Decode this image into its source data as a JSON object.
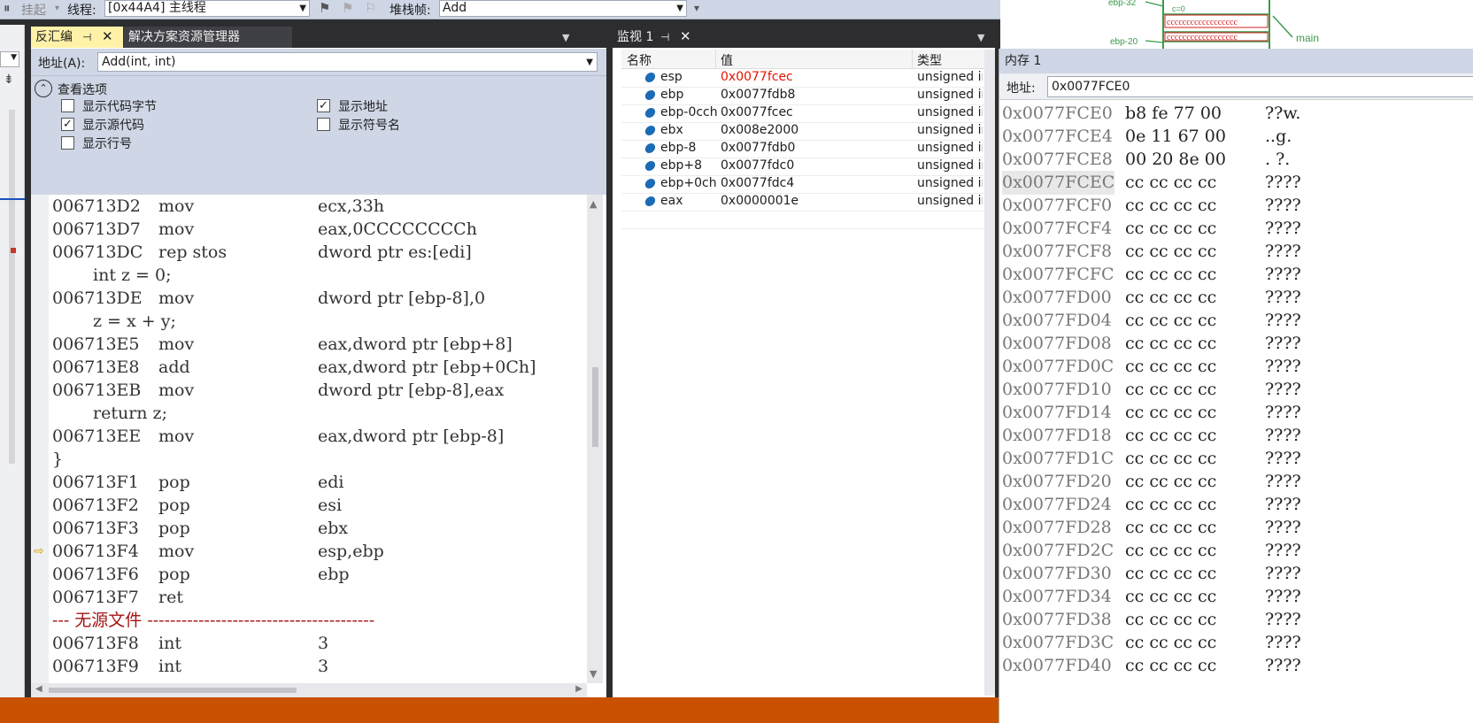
{
  "toolbar": {
    "suspend_label": "挂起",
    "thread_label": "线程:",
    "thread_value": "[0x44A4] 主线程",
    "stackframe_label": "堆栈帧:",
    "stackframe_value": "Add"
  },
  "disasm": {
    "tab_active": "反汇编",
    "tab_inactive": "解决方案资源管理器",
    "address_label": "地址(A):",
    "address_value": "Add(int, int)",
    "options_title": "查看选项",
    "options": [
      {
        "label": "显示代码字节",
        "checked": false
      },
      {
        "label": "显示源代码",
        "checked": true
      },
      {
        "label": "显示行号",
        "checked": false
      },
      {
        "label": "显示地址",
        "checked": true
      },
      {
        "label": "显示符号名",
        "checked": false
      }
    ],
    "lines": [
      {
        "addr": "006713D2",
        "mnem": "mov",
        "ops": "ecx,33h"
      },
      {
        "addr": "006713D7",
        "mnem": "mov",
        "ops": "eax,0CCCCCCCCh"
      },
      {
        "addr": "006713DC",
        "mnem": "rep stos",
        "ops": "dword ptr es:[edi]"
      },
      {
        "src": "int z = 0;"
      },
      {
        "addr": "006713DE",
        "mnem": "mov",
        "ops": "dword ptr [ebp-8],0"
      },
      {
        "src": "z = x + y;"
      },
      {
        "addr": "006713E5",
        "mnem": "mov",
        "ops": "eax,dword ptr [ebp+8]"
      },
      {
        "addr": "006713E8",
        "mnem": "add",
        "ops": "eax,dword ptr [ebp+0Ch]"
      },
      {
        "addr": "006713EB",
        "mnem": "mov",
        "ops": "dword ptr [ebp-8],eax"
      },
      {
        "src": "return z;"
      },
      {
        "addr": "006713EE",
        "mnem": "mov",
        "ops": "eax,dword ptr [ebp-8]"
      },
      {
        "brace": "}"
      },
      {
        "addr": "006713F1",
        "mnem": "pop",
        "ops": "edi"
      },
      {
        "addr": "006713F2",
        "mnem": "pop",
        "ops": "esi"
      },
      {
        "addr": "006713F3",
        "mnem": "pop",
        "ops": "ebx"
      },
      {
        "addr": "006713F4",
        "mnem": "mov",
        "ops": "esp,ebp",
        "current": true
      },
      {
        "addr": "006713F6",
        "mnem": "pop",
        "ops": "ebp"
      },
      {
        "addr": "006713F7",
        "mnem": "ret",
        "ops": ""
      },
      {
        "nosrc": "--- 无源文件 ----------------------------------------"
      },
      {
        "addr": "006713F8",
        "mnem": "int",
        "ops": "3"
      },
      {
        "addr": "006713F9",
        "mnem": "int",
        "ops": "3"
      }
    ]
  },
  "watch": {
    "tab": "监视 1",
    "headers": {
      "name": "名称",
      "value": "值",
      "type": "类型"
    },
    "rows": [
      {
        "name": "esp",
        "value": "0x0077fcec",
        "type": "unsigned int",
        "changed": true
      },
      {
        "name": "ebp",
        "value": "0x0077fdb8",
        "type": "unsigned int"
      },
      {
        "name": "ebp-0cch",
        "value": "0x0077fcec",
        "type": "unsigned int"
      },
      {
        "name": "ebx",
        "value": "0x008e2000",
        "type": "unsigned int"
      },
      {
        "name": "ebp-8",
        "value": "0x0077fdb0",
        "type": "unsigned int"
      },
      {
        "name": "ebp+8",
        "value": "0x0077fdc0",
        "type": "unsigned int"
      },
      {
        "name": "ebp+0ch",
        "value": "0x0077fdc4",
        "type": "unsigned int"
      },
      {
        "name": "eax",
        "value": "0x0000001e",
        "type": "unsigned int"
      }
    ]
  },
  "diagram": {
    "ebp_minus_32": "ebp-32",
    "ebp_minus_20": "ebp-20",
    "c_eq_0": "c=0",
    "main_label": "main",
    "cc_fill": "cccccccccccccccccc"
  },
  "memory": {
    "title": "内存 1",
    "address_label": "地址:",
    "address_value": "0x0077FCE0",
    "rows": [
      {
        "addr": "0x0077FCE0",
        "bytes": "b8 fe 77 00",
        "chars": "??w."
      },
      {
        "addr": "0x0077FCE4",
        "bytes": "0e 11 67 00",
        "chars": "..g."
      },
      {
        "addr": "0x0077FCE8",
        "bytes": "00 20 8e 00",
        "chars": ". ?."
      },
      {
        "addr": "0x0077FCEC",
        "bytes": "cc cc cc cc",
        "chars": "????",
        "highlight": true
      },
      {
        "addr": "0x0077FCF0",
        "bytes": "cc cc cc cc",
        "chars": "????"
      },
      {
        "addr": "0x0077FCF4",
        "bytes": "cc cc cc cc",
        "chars": "????"
      },
      {
        "addr": "0x0077FCF8",
        "bytes": "cc cc cc cc",
        "chars": "????"
      },
      {
        "addr": "0x0077FCFC",
        "bytes": "cc cc cc cc",
        "chars": "????"
      },
      {
        "addr": "0x0077FD00",
        "bytes": "cc cc cc cc",
        "chars": "????"
      },
      {
        "addr": "0x0077FD04",
        "bytes": "cc cc cc cc",
        "chars": "????"
      },
      {
        "addr": "0x0077FD08",
        "bytes": "cc cc cc cc",
        "chars": "????"
      },
      {
        "addr": "0x0077FD0C",
        "bytes": "cc cc cc cc",
        "chars": "????"
      },
      {
        "addr": "0x0077FD10",
        "bytes": "cc cc cc cc",
        "chars": "????"
      },
      {
        "addr": "0x0077FD14",
        "bytes": "cc cc cc cc",
        "chars": "????"
      },
      {
        "addr": "0x0077FD18",
        "bytes": "cc cc cc cc",
        "chars": "????"
      },
      {
        "addr": "0x0077FD1C",
        "bytes": "cc cc cc cc",
        "chars": "????"
      },
      {
        "addr": "0x0077FD20",
        "bytes": "cc cc cc cc",
        "chars": "????"
      },
      {
        "addr": "0x0077FD24",
        "bytes": "cc cc cc cc",
        "chars": "????"
      },
      {
        "addr": "0x0077FD28",
        "bytes": "cc cc cc cc",
        "chars": "????"
      },
      {
        "addr": "0x0077FD2C",
        "bytes": "cc cc cc cc",
        "chars": "????"
      },
      {
        "addr": "0x0077FD30",
        "bytes": "cc cc cc cc",
        "chars": "????"
      },
      {
        "addr": "0x0077FD34",
        "bytes": "cc cc cc cc",
        "chars": "????"
      },
      {
        "addr": "0x0077FD38",
        "bytes": "cc cc cc cc",
        "chars": "????"
      },
      {
        "addr": "0x0077FD3C",
        "bytes": "cc cc cc cc",
        "chars": "????"
      },
      {
        "addr": "0x0077FD40",
        "bytes": "cc cc cc cc",
        "chars": "????"
      }
    ]
  },
  "colors": {
    "status_bar": "#ca5100",
    "changed_value": "#e51400",
    "diagram_green": "#3a9a4a",
    "diagram_red": "#d02020",
    "tab_active_bg": "#fff1a8"
  }
}
